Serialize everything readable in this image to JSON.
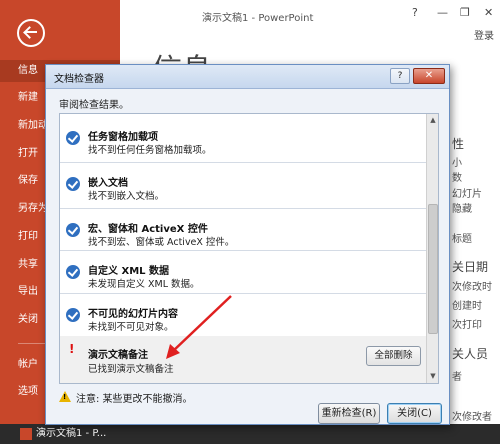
{
  "window": {
    "title": "演示文稿1 - PowerPoint",
    "help": "?",
    "minimize": "—",
    "restore": "❐",
    "close": "✕",
    "login": "登录"
  },
  "backstage": {
    "heading": "信息",
    "nav": [
      {
        "label": "信息",
        "active": true
      },
      {
        "label": "新建"
      },
      {
        "label": "新加动"
      },
      {
        "label": "打开"
      },
      {
        "label": "保存"
      },
      {
        "label": "另存为"
      },
      {
        "label": "打印"
      },
      {
        "label": "共享"
      },
      {
        "label": "导出"
      },
      {
        "label": "关闭"
      },
      {
        "label": "帐户"
      },
      {
        "label": "选项"
      }
    ],
    "right_partial": [
      "性",
      "小",
      "数",
      "幻灯片",
      "隐藏",
      "标题",
      "关日期",
      "次修改时",
      "创建时",
      "次打印",
      "关人员",
      "者",
      "次修改者"
    ]
  },
  "taskbar": {
    "item": "演示文稿1 - P..."
  },
  "dialog": {
    "title": "文档检查器",
    "help_label": "?",
    "close_label": "✕",
    "subtitle": "审阅检查结果。",
    "results": [
      {
        "title": "任务窗格加载项",
        "desc": "找不到任何任务窗格加载项。",
        "status": "ok"
      },
      {
        "title": "嵌入文档",
        "desc": "找不到嵌入文档。",
        "status": "ok"
      },
      {
        "title": "宏、窗体和 ActiveX 控件",
        "desc": "找不到宏、窗体或 ActiveX 控件。",
        "status": "ok"
      },
      {
        "title": "自定义 XML 数据",
        "desc": "未发现自定义 XML 数据。",
        "status": "ok"
      },
      {
        "title": "不可见的幻灯片内容",
        "desc": "未找到不可见对象。",
        "status": "ok"
      },
      {
        "title": "演示文稿备注",
        "desc": "已找到演示文稿备注",
        "status": "warn",
        "mark": "!",
        "action": "全部删除"
      }
    ],
    "footer_note": "注意: 某些更改不能撤消。",
    "recheck_button": "重新检查(R)",
    "close_button": "关闭(C)"
  },
  "colors": {
    "accent": "#c8472a",
    "check": "#2f6fc0",
    "warning": "#d11111",
    "annotation_arrow": "#e02020"
  },
  "icons": {
    "back": "back-arrow-icon",
    "check": "check-circle-icon",
    "warning": "warning-triangle-icon"
  }
}
